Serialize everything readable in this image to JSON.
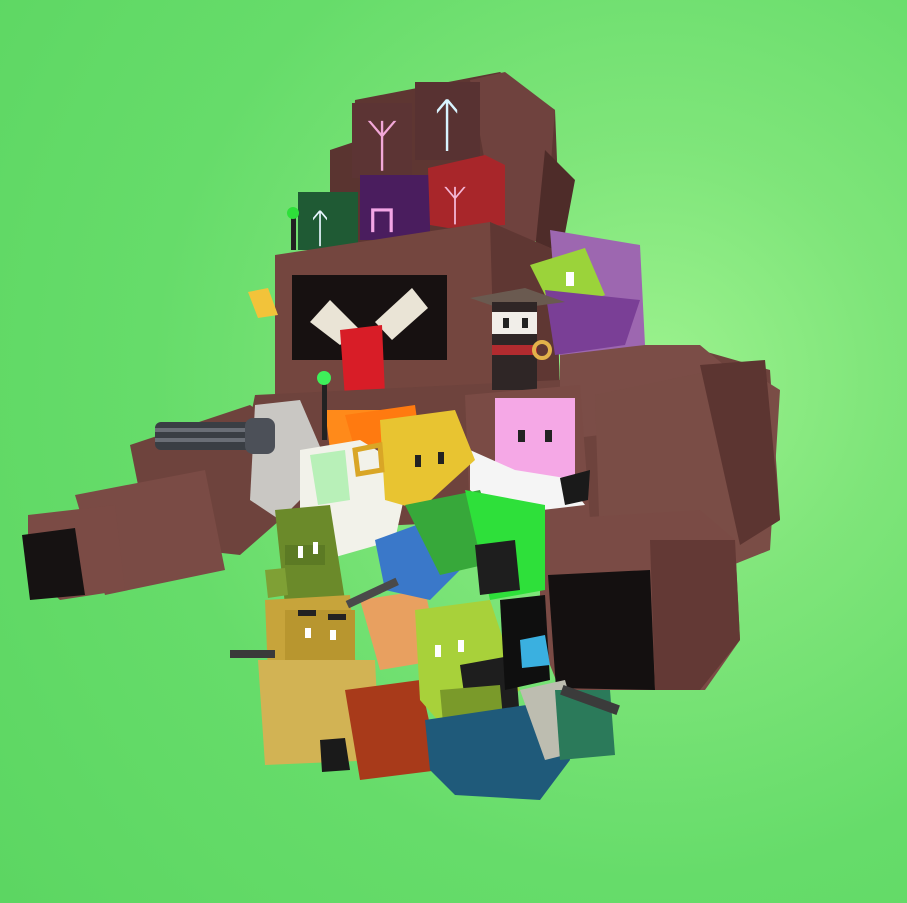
{
  "scene": {
    "type": "voxel-game-render",
    "background_color": "#66dc6a",
    "main_subject": "giant-brown-voxel-golem",
    "golem_color": "#7a4a44",
    "head_rune_glyphs": [
      "ᛉ",
      "ᛏ",
      "ᛏ",
      "⊓",
      "ᛉ"
    ],
    "characters": [
      {
        "name": "samurai-character",
        "color": "#3a2a2a"
      },
      {
        "name": "pink-character",
        "color": "#f5a8e6"
      },
      {
        "name": "yellow-character",
        "color": "#e8c431"
      },
      {
        "name": "lime-character",
        "color": "#a8d13a"
      },
      {
        "name": "olive-character",
        "color": "#c7a43b"
      },
      {
        "name": "green-soldier",
        "color": "#7a9a2a"
      },
      {
        "name": "orange-character",
        "color": "#ff8a1a"
      },
      {
        "name": "white-character",
        "color": "#f5f5f0"
      },
      {
        "name": "blue-character",
        "color": "#3a78c9"
      }
    ],
    "weapons": [
      "minigun-icon",
      "rifle-icon",
      "antenna-icon"
    ]
  }
}
